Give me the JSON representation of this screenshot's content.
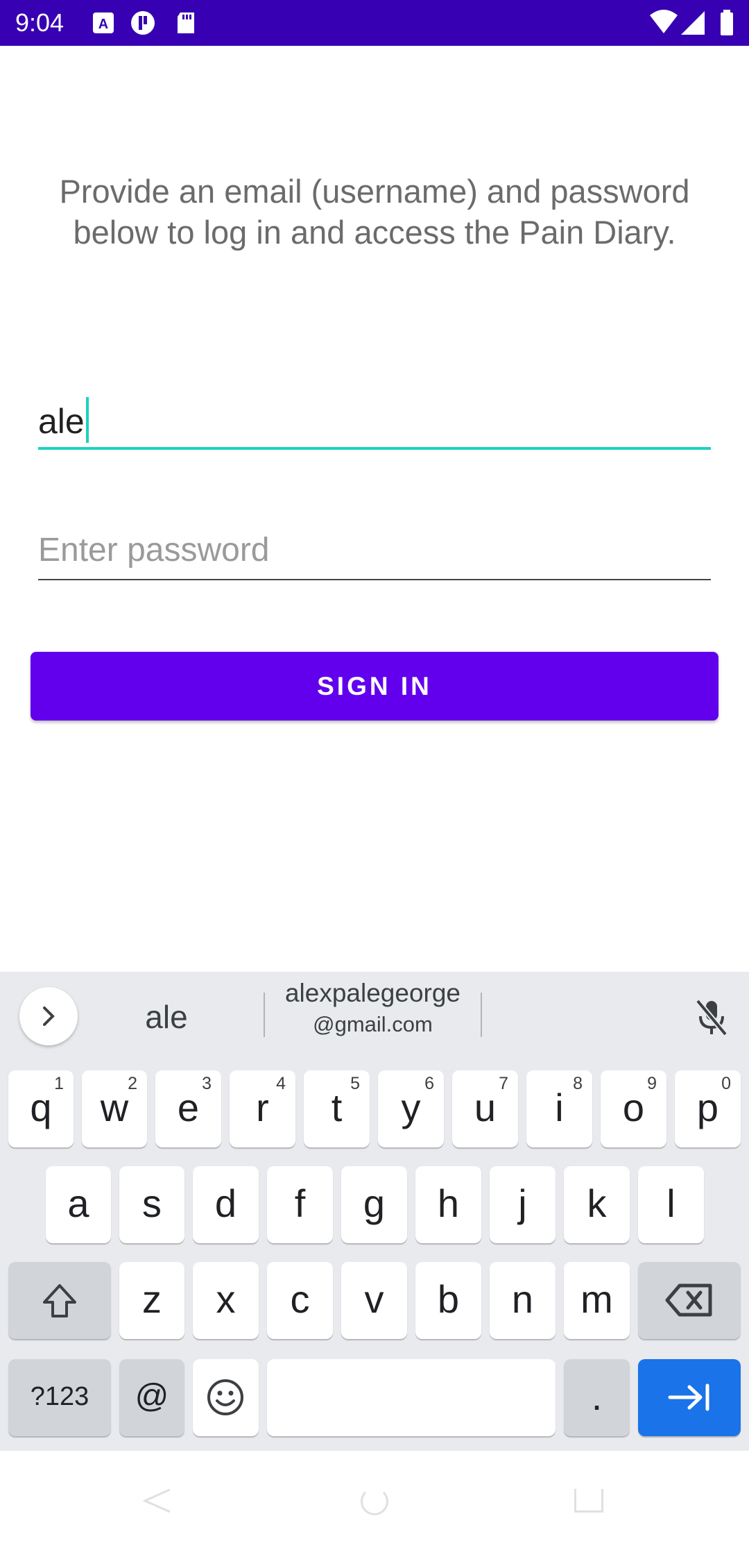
{
  "status_bar": {
    "time": "9:04",
    "left_icons": [
      "keyboard-a-icon",
      "sync-p-icon",
      "sd-card-icon"
    ],
    "right_icons": [
      "wifi-icon",
      "signal-icon",
      "battery-icon"
    ],
    "background": "#3700b3"
  },
  "login": {
    "instructions": "Provide an email (username) and password below to log in and access the Pain Diary.",
    "email_value": "ale",
    "password_placeholder": "Enter password",
    "signin_label": "SIGN IN",
    "accent_color": "#1fd1c1",
    "button_color": "#6200ee"
  },
  "keyboard": {
    "suggestions": {
      "first": "ale",
      "second_line1": "alexpalegeorge",
      "second_line2": "@gmail.com"
    },
    "row1": [
      {
        "ch": "q",
        "hint": "1"
      },
      {
        "ch": "w",
        "hint": "2"
      },
      {
        "ch": "e",
        "hint": "3"
      },
      {
        "ch": "r",
        "hint": "4"
      },
      {
        "ch": "t",
        "hint": "5"
      },
      {
        "ch": "y",
        "hint": "6"
      },
      {
        "ch": "u",
        "hint": "7"
      },
      {
        "ch": "i",
        "hint": "8"
      },
      {
        "ch": "o",
        "hint": "9"
      },
      {
        "ch": "p",
        "hint": "0"
      }
    ],
    "row2": [
      "a",
      "s",
      "d",
      "f",
      "g",
      "h",
      "j",
      "k",
      "l"
    ],
    "row3": [
      "z",
      "x",
      "c",
      "v",
      "b",
      "n",
      "m"
    ],
    "row4": {
      "symbols_label": "?123",
      "at_label": "@",
      "period_label": "."
    }
  }
}
